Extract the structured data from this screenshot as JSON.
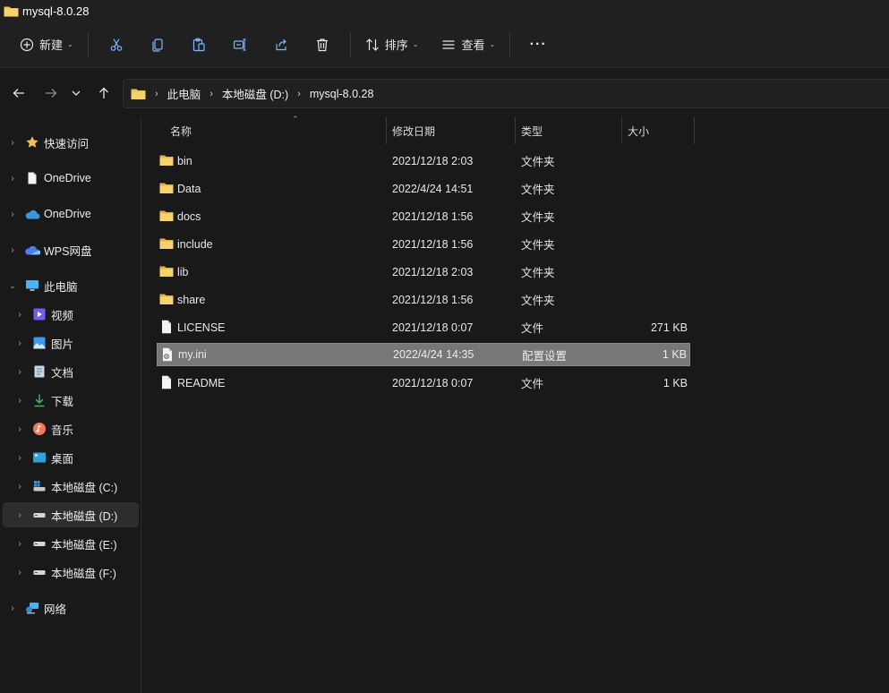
{
  "window": {
    "title": "mysql-8.0.28"
  },
  "toolbar": {
    "new_label": "新建",
    "sort_label": "排序",
    "view_label": "查看",
    "more_label": "···"
  },
  "address": {
    "crumbs": [
      "此电脑",
      "本地磁盘 (D:)",
      "mysql-8.0.28"
    ]
  },
  "sidebar": {
    "items": [
      {
        "label": "快速访问",
        "icon": "star-icon"
      },
      {
        "label": "OneDrive",
        "icon": "document-icon"
      },
      {
        "label": "OneDrive",
        "icon": "cloud-icon"
      },
      {
        "label": "WPS网盘",
        "icon": "wps-cloud-icon"
      },
      {
        "label": "此电脑",
        "icon": "monitor-icon"
      },
      {
        "label": "视频",
        "icon": "video-icon"
      },
      {
        "label": "图片",
        "icon": "picture-icon"
      },
      {
        "label": "文档",
        "icon": "documents-icon"
      },
      {
        "label": "下载",
        "icon": "download-icon"
      },
      {
        "label": "音乐",
        "icon": "music-icon"
      },
      {
        "label": "桌面",
        "icon": "desktop-icon"
      },
      {
        "label": "本地磁盘 (C:)",
        "icon": "system-drive-icon"
      },
      {
        "label": "本地磁盘 (D:)",
        "icon": "drive-icon"
      },
      {
        "label": "本地磁盘 (E:)",
        "icon": "drive-icon"
      },
      {
        "label": "本地磁盘 (F:)",
        "icon": "drive-icon"
      },
      {
        "label": "网络",
        "icon": "network-icon"
      }
    ]
  },
  "columns": {
    "name": "名称",
    "date": "修改日期",
    "type": "类型",
    "size": "大小"
  },
  "files": [
    {
      "name": "bin",
      "date": "2021/12/18 2:03",
      "type": "文件夹",
      "size": "",
      "icon": "folder-icon"
    },
    {
      "name": "Data",
      "date": "2022/4/24 14:51",
      "type": "文件夹",
      "size": "",
      "icon": "folder-icon"
    },
    {
      "name": "docs",
      "date": "2021/12/18 1:56",
      "type": "文件夹",
      "size": "",
      "icon": "folder-icon"
    },
    {
      "name": "include",
      "date": "2021/12/18 1:56",
      "type": "文件夹",
      "size": "",
      "icon": "folder-icon"
    },
    {
      "name": "lib",
      "date": "2021/12/18 2:03",
      "type": "文件夹",
      "size": "",
      "icon": "folder-icon"
    },
    {
      "name": "share",
      "date": "2021/12/18 1:56",
      "type": "文件夹",
      "size": "",
      "icon": "folder-icon"
    },
    {
      "name": "LICENSE",
      "date": "2021/12/18 0:07",
      "type": "文件",
      "size": "271 KB",
      "icon": "file-icon"
    },
    {
      "name": "my.ini",
      "date": "2022/4/24 14:35",
      "type": "配置设置",
      "size": "1 KB",
      "icon": "settings-file-icon"
    },
    {
      "name": "README",
      "date": "2021/12/18 0:07",
      "type": "文件",
      "size": "1 KB",
      "icon": "file-icon"
    }
  ],
  "colors": {
    "folder": "#f2c14e",
    "accent": "#4cc2ff",
    "selection": "#777777"
  }
}
